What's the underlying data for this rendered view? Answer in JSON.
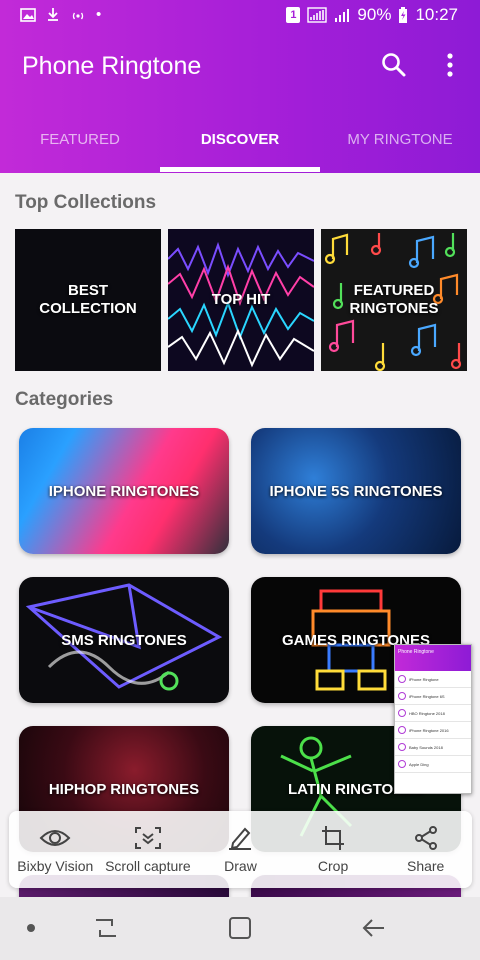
{
  "status_bar": {
    "sim_label": "1",
    "battery": "90%",
    "time": "10:27"
  },
  "header": {
    "title": "Phone Ringtone",
    "search_icon": "search-icon",
    "more_icon": "more-vert-icon"
  },
  "tabs": [
    {
      "label": "FEATURED",
      "active": false
    },
    {
      "label": "DISCOVER",
      "active": true
    },
    {
      "label": "MY RINGTONE",
      "active": false
    }
  ],
  "top_collections": {
    "title": "Top Collections",
    "items": [
      {
        "label": "BEST\nCOLLECTION"
      },
      {
        "label": "TOP HIT"
      },
      {
        "label": "FEATURED\nRINGTONES"
      }
    ]
  },
  "categories": {
    "title": "Categories",
    "items": [
      {
        "label": "IPHONE RINGTONES"
      },
      {
        "label": "IPHONE 5S RINGTONES"
      },
      {
        "label": "SMS RINGTONES"
      },
      {
        "label": "GAMES RINGTONES"
      },
      {
        "label": "HIPHOP RINGTONES"
      },
      {
        "label": "LATIN RINGTONES"
      }
    ]
  },
  "preview": {
    "title": "Phone Ringtone",
    "rows": [
      "iPhone Ringtone",
      "iPhone Ringtone 6S",
      "HBO Ringtone 2018",
      "iPhone Ringtone 2016",
      "Baby Sounds 2018",
      "Apple Ding"
    ]
  },
  "capture_toolbar": {
    "items": [
      {
        "label": "Bixby Vision",
        "icon": "eye-icon"
      },
      {
        "label": "Scroll capture",
        "icon": "scroll-capture-icon"
      },
      {
        "label": "Draw",
        "icon": "pen-icon"
      },
      {
        "label": "Crop",
        "icon": "crop-icon"
      },
      {
        "label": "Share",
        "icon": "share-icon"
      }
    ]
  },
  "colors": {
    "header_start": "#c22ad8",
    "header_end": "#8e1bd6",
    "section_title": "#6a6a6a"
  }
}
